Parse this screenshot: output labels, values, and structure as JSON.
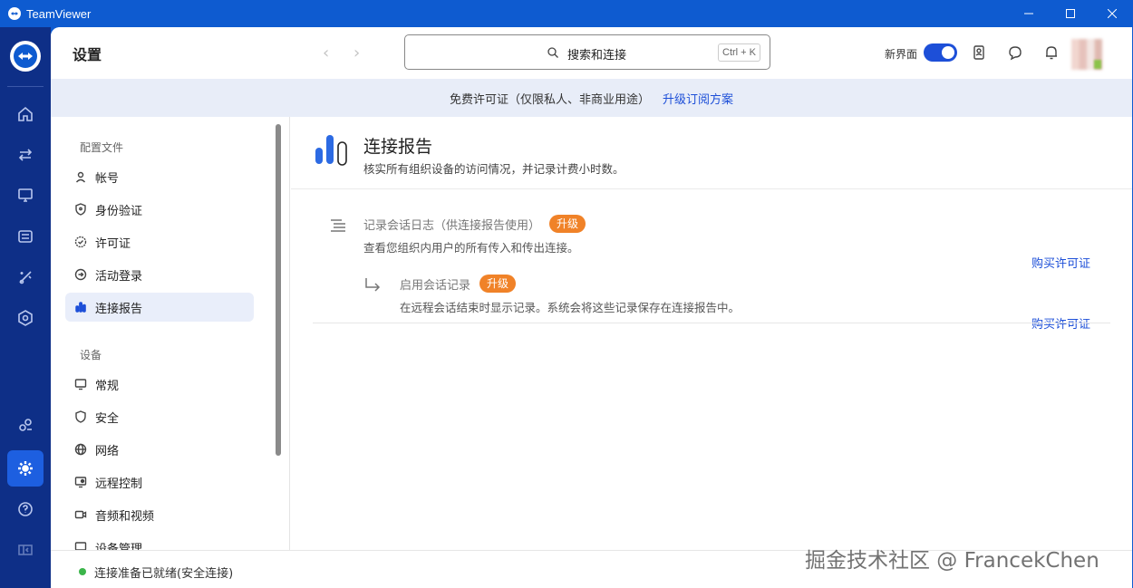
{
  "window": {
    "app_title": "TeamViewer",
    "controls": [
      "minimize-icon",
      "maximize-icon",
      "close-icon"
    ]
  },
  "rail": {
    "items": [
      "home-icon",
      "transfer-icon",
      "remote-device-icon",
      "devices-icon",
      "magic-icon",
      "security-icon",
      "people-icon",
      "settings-icon",
      "help-icon",
      "collapse-icon"
    ],
    "active": "settings-icon"
  },
  "header": {
    "title": "设置",
    "search_label": "搜索和连接",
    "search_shortcut": "Ctrl + K",
    "new_ui_label": "新界面",
    "new_ui_enabled": true
  },
  "banner": {
    "text": "免费许可证（仅限私人、非商业用途）",
    "link": "升级订阅方案"
  },
  "sidebar": {
    "group1": "配置文件",
    "group1_items": [
      {
        "label": "帐号",
        "icon": "user-icon"
      },
      {
        "label": "身份验证",
        "icon": "shield-icon"
      },
      {
        "label": "许可证",
        "icon": "check-badge-icon"
      },
      {
        "label": "活动登录",
        "icon": "arrow-circle-icon"
      },
      {
        "label": "连接报告",
        "icon": "bar-chart-icon",
        "active": true
      }
    ],
    "group2": "设备",
    "group2_items": [
      {
        "label": "常规",
        "icon": "monitor-icon"
      },
      {
        "label": "安全",
        "icon": "shield-icon"
      },
      {
        "label": "网络",
        "icon": "globe-icon"
      },
      {
        "label": "远程控制",
        "icon": "remote-control-icon"
      },
      {
        "label": "音频和视频",
        "icon": "video-icon"
      },
      {
        "label": "设备管理",
        "icon": "device-manage-icon"
      }
    ]
  },
  "content": {
    "title": "连接报告",
    "description": "核实所有组织设备的访问情况，并记录计费小时数。",
    "rows": [
      {
        "title": "记录会话日志（供连接报告使用）",
        "badge": "升级",
        "description": "查看您组织内用户的所有传入和传出连接。",
        "link": "购买许可证"
      },
      {
        "title": "启用会话记录",
        "badge": "升级",
        "description": "在远程会话结束时显示记录。系统会将这些记录保存在连接报告中。",
        "link": "购买许可证"
      }
    ]
  },
  "status": {
    "text": "连接准备已就绪(安全连接)",
    "color": "#3bb54a"
  },
  "watermark": "掘金技术社区 @ FrancekChen",
  "colors": {
    "brand": "#0e5bd0",
    "rail": "#0e2f87",
    "accent": "#1d4fd8",
    "badge": "#f08228"
  }
}
